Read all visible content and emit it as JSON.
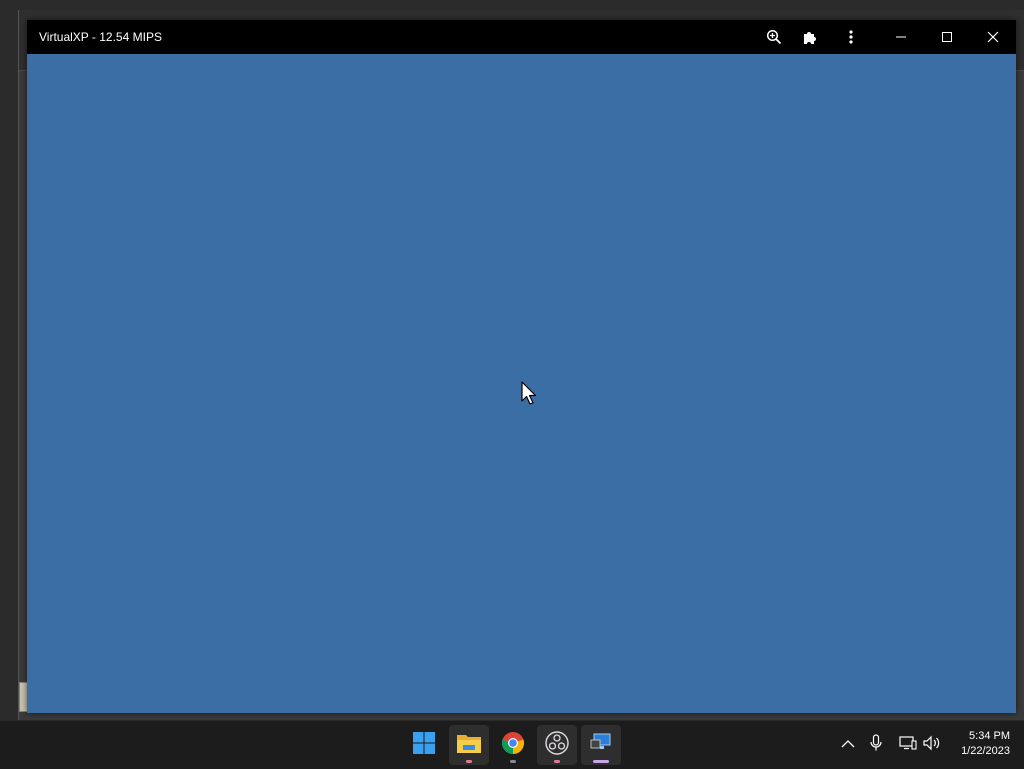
{
  "window": {
    "title": "VirtualXP - 12.54 MIPS",
    "toolbar_icons": [
      "zoom-icon",
      "extension-icon",
      "more-vert-icon"
    ],
    "controls": [
      "minimize-icon",
      "maximize-icon",
      "close-icon"
    ]
  },
  "viewport": {
    "background_color": "#3b6ea5"
  },
  "taskbar": {
    "apps": [
      {
        "name": "start-icon",
        "active": false
      },
      {
        "name": "file-explorer-icon",
        "active": true
      },
      {
        "name": "chrome-icon",
        "active": false
      },
      {
        "name": "obs-icon",
        "active": true
      },
      {
        "name": "remote-desktop-icon",
        "active": true
      }
    ],
    "tray_icons": [
      "chevron-up-icon",
      "microphone-icon",
      "network-icon",
      "volume-icon"
    ],
    "clock": {
      "time": "5:34 PM",
      "date": "1/22/2023"
    }
  }
}
